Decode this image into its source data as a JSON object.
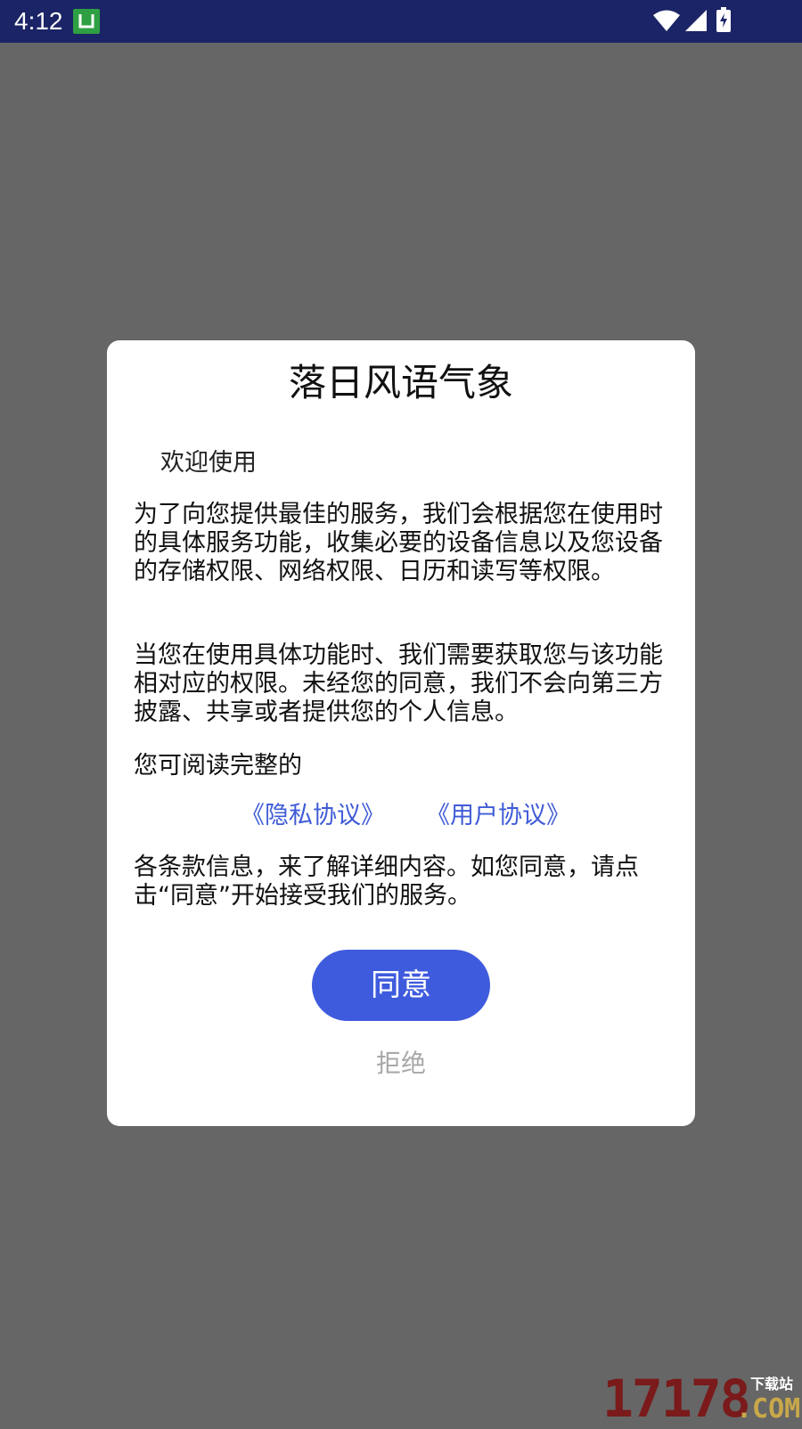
{
  "status_bar": {
    "time": "4:12",
    "app_icon": "app-notification-icon",
    "icons": [
      "wifi-icon",
      "signal-icon",
      "battery-charging-icon"
    ]
  },
  "dialog": {
    "title": "落日风语气象",
    "welcome": "欢迎使用",
    "paragraph_1": "为了向您提供最佳的服务，我们会根据您在使用时的具体服务功能，收集必要的设备信息以及您设备的存储权限、网络权限、日历和读写等权限。",
    "paragraph_2": "当您在使用具体功能时、我们需要获取您与该功能相对应的权限。未经您的同意，我们不会向第三方披露、共享或者提供您的个人信息。",
    "paragraph_3": "您可阅读完整的",
    "privacy_link": "《隐私协议》",
    "user_link": "《用户协议》",
    "paragraph_4": "各条款信息，来了解详细内容。如您同意，请点击“同意”开始接受我们的服务。",
    "agree_label": "同意",
    "reject_label": "拒绝"
  },
  "watermark": {
    "digits": "17178",
    "site": "下载站",
    "com": ".COM"
  },
  "colors": {
    "status_bar": "#1b2466",
    "backdrop": "#666666",
    "accent": "#3f5bdd",
    "link": "#3f5bd6",
    "reject_text": "#a8a8a8"
  }
}
